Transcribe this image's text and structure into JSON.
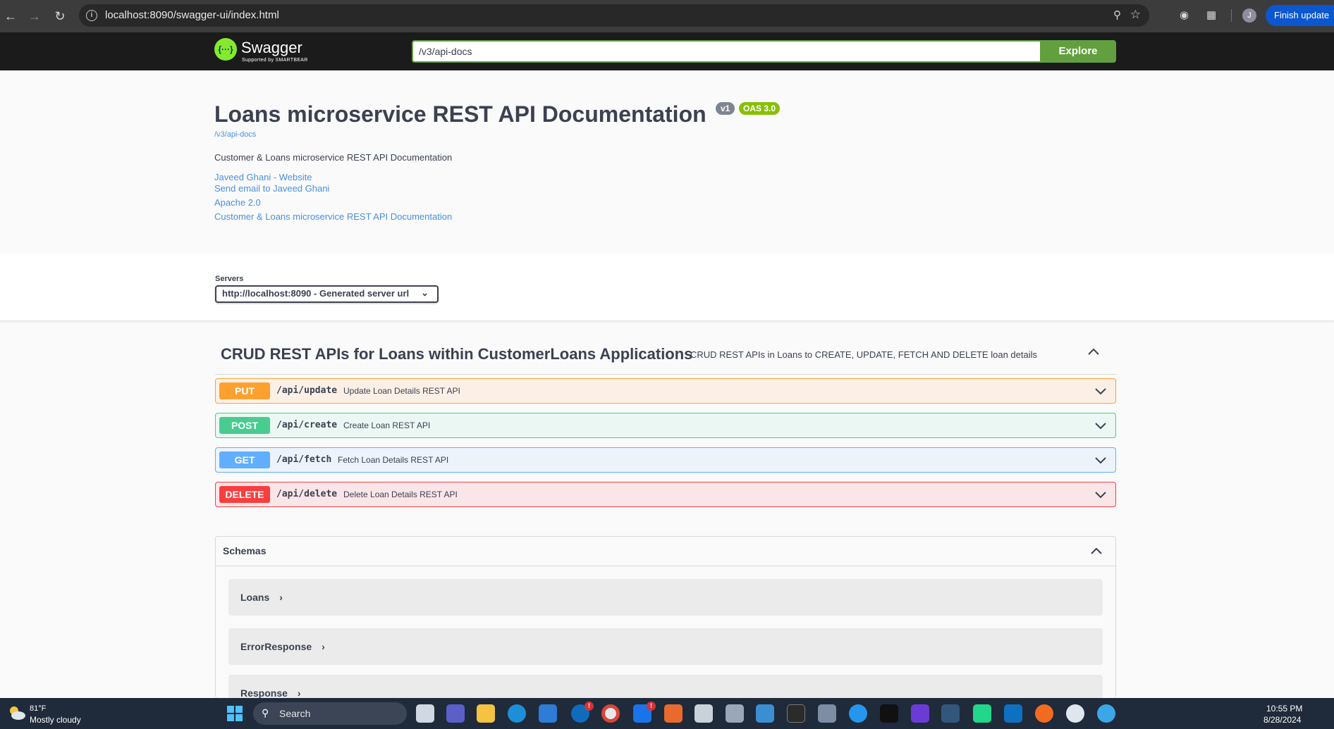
{
  "browser": {
    "url": "localhost:8090/swagger-ui/index.html",
    "update_label": "Finish update",
    "profile_initial": "J"
  },
  "topbar": {
    "logo_text": "Swagger",
    "logo_badge": "{···}",
    "logo_sub": "Supported by SMARTBEAR",
    "spec_url": "/v3/api-docs",
    "explore_label": "Explore"
  },
  "info": {
    "title": "Loans microservice REST API Documentation",
    "version": "v1",
    "oas": "OAS 3.0",
    "spec_link": "/v3/api-docs",
    "description": "Customer & Loans microservice REST API Documentation",
    "links": [
      "Javeed Ghani - Website",
      "Send email to Javeed Ghani",
      "Apache 2.0",
      "Customer & Loans microservice REST API Documentation"
    ]
  },
  "servers": {
    "label": "Servers",
    "selected": "http://localhost:8090 - Generated server url"
  },
  "tag": {
    "name": "CRUD REST APIs for Loans within CustomerLoans Applications",
    "description": "CRUD REST APIs in Loans to CREATE, UPDATE, FETCH AND DELETE loan details"
  },
  "operations": [
    {
      "method": "PUT",
      "path": "/api/update",
      "summary": "Update Loan Details REST API"
    },
    {
      "method": "POST",
      "path": "/api/create",
      "summary": "Create Loan REST API"
    },
    {
      "method": "GET",
      "path": "/api/fetch",
      "summary": "Fetch Loan Details REST API"
    },
    {
      "method": "DELETE",
      "path": "/api/delete",
      "summary": "Delete Loan Details REST API"
    }
  ],
  "schemas": {
    "title": "Schemas",
    "models": [
      "Loans",
      "ErrorResponse",
      "Response"
    ]
  },
  "taskbar": {
    "temperature": "81°F",
    "weather": "Mostly cloudy",
    "search_label": "Search",
    "time": "10:55 PM",
    "date": "8/28/2024"
  }
}
